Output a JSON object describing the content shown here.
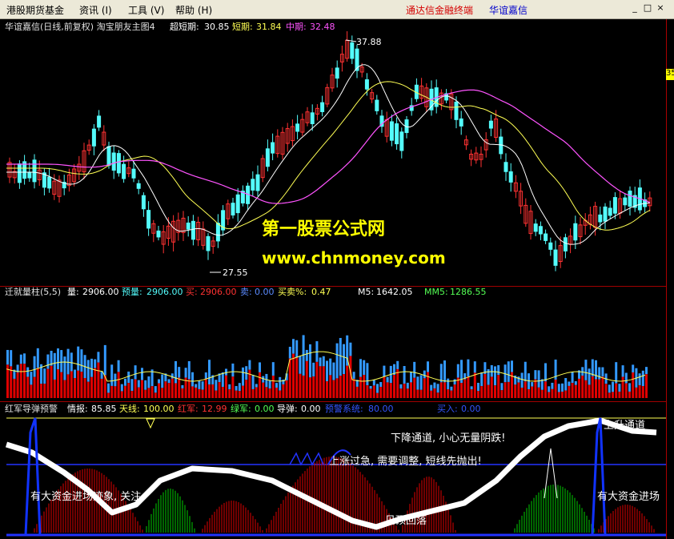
{
  "menu": {
    "items": [
      "港股期货基金",
      "资讯 (I)",
      "工具 (V)",
      "帮助 (H)"
    ],
    "brand_red": "通达信金融终端",
    "brand_blue": "华谊嘉信"
  },
  "main_panel": {
    "title": "华谊嘉信(日线,前复权) 淘宝朋友主图4",
    "super_short_label": "超短期:",
    "super_short_value": "30.85",
    "short_label": "短期:",
    "short_value": "31.84",
    "mid_label": "中期:",
    "mid_value": "32.48",
    "high_marker": "37.88",
    "low_marker": "27.55",
    "right_price_tag": "35"
  },
  "watermark": {
    "line1": "第一股票公式网",
    "line2": "www.chnmoney.com"
  },
  "volume_panel": {
    "title": "迁就量柱(5,5)",
    "vol_label": "量:",
    "vol_value": "2906.00",
    "pre_label": "预量:",
    "pre_value": "2906.00",
    "buy_label": "买:",
    "buy_value": "2906.00",
    "sell_label": "卖:",
    "sell_value": "0.00",
    "pct_label": "买卖%:",
    "pct_value": "0.47",
    "m5_label": "M5:",
    "m5_value": "1642.05",
    "mm5_label": "MM5:",
    "mm5_value": "1286.55"
  },
  "indicator_panel": {
    "title": "红军导弹预警",
    "intel_label": "情报:",
    "intel_value": "85.85",
    "sky_label": "天线:",
    "sky_value": "100.00",
    "red_label": "红军:",
    "red_value": "12.99",
    "green_label": "绿军:",
    "green_value": "0.00",
    "missile_label": "导弹:",
    "missile_value": "0.00",
    "warn_label": "预警系统:",
    "warn_value": "80.00",
    "buy_in_label": "买入:",
    "buy_in_value": "0.00"
  },
  "annotations": {
    "up_channel": "上升通道",
    "down_channel": "下降通道, 小心无量阴跌!",
    "overheat": "上涨过急, 需要调整, 短线先抛出!",
    "funds_left": "有大资金进场迹象, 关注",
    "funds_right": "有大资金进场",
    "pullback": "见顶回落"
  },
  "colors": {
    "up": "#ff3232",
    "down": "#54fcfc",
    "ma_white": "#ffffff",
    "ma_yellow": "#ffff54",
    "ma_magenta": "#ff54ff",
    "vol_blue": "#3399ff",
    "vol_red": "#e00000"
  }
}
